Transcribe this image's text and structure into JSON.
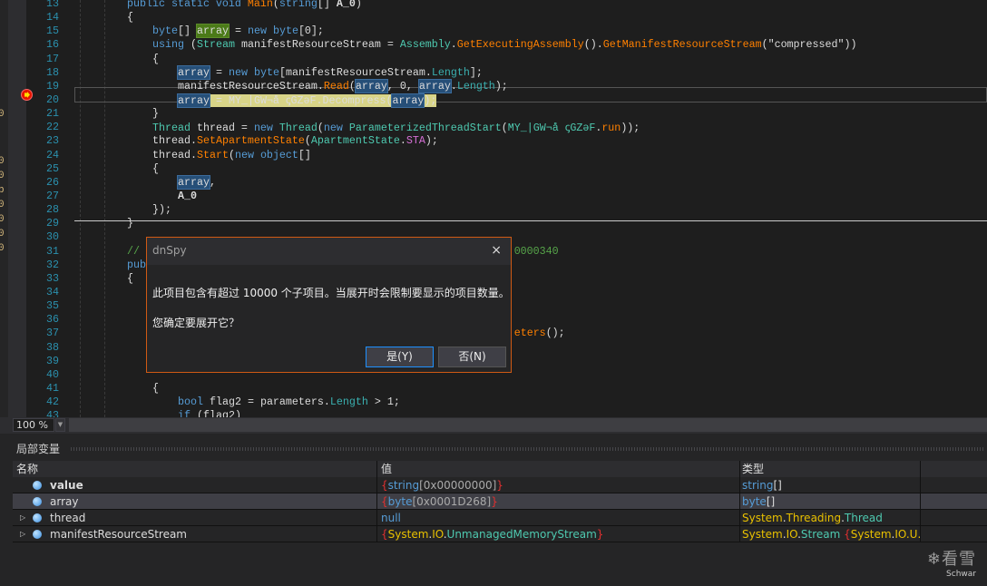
{
  "code_lines": [
    {
      "n": "13",
      "indent": 0,
      "tokens": [
        [
          "public static void ",
          "kw"
        ],
        [
          "Main",
          "me"
        ],
        [
          "(",
          "pl"
        ],
        [
          "string",
          "kw"
        ],
        [
          "[] ",
          "pl"
        ],
        [
          "A_0",
          "bo"
        ],
        [
          ")",
          "pl"
        ]
      ]
    },
    {
      "n": "14",
      "indent": 0,
      "tokens": [
        [
          "{",
          "pl"
        ]
      ]
    },
    {
      "n": "15",
      "indent": 1,
      "tokens": [
        [
          "byte",
          "kw"
        ],
        [
          "[] ",
          "pl"
        ],
        [
          "array",
          "hlg"
        ],
        [
          " = ",
          "pl"
        ],
        [
          "new ",
          "kw"
        ],
        [
          "byte",
          "kw"
        ],
        [
          "[0];",
          "pl"
        ]
      ]
    },
    {
      "n": "16",
      "indent": 1,
      "tokens": [
        [
          "using ",
          "kw"
        ],
        [
          "(",
          "pl"
        ],
        [
          "Stream ",
          "ty"
        ],
        [
          "manifestResourceStream = ",
          "pl"
        ],
        [
          "Assembly",
          "ty"
        ],
        [
          ".",
          "pl"
        ],
        [
          "GetExecutingAssembly",
          "me"
        ],
        [
          "().",
          "pl"
        ],
        [
          "GetManifestResourceStream",
          "me"
        ],
        [
          "(\"compressed\"))",
          "pl"
        ]
      ]
    },
    {
      "n": "17",
      "indent": 1,
      "tokens": [
        [
          "{",
          "pl"
        ]
      ]
    },
    {
      "n": "18",
      "indent": 2,
      "tokens": [
        [
          "array",
          "hl"
        ],
        [
          " = ",
          "pl"
        ],
        [
          "new ",
          "kw"
        ],
        [
          "byte",
          "kw"
        ],
        [
          "[manifestResourceStream.",
          "pl"
        ],
        [
          "Length",
          "pr"
        ],
        [
          "];",
          "pl"
        ]
      ]
    },
    {
      "n": "19",
      "indent": 2,
      "tokens": [
        [
          "manifestResourceStream.",
          "pl"
        ],
        [
          "Read",
          "me"
        ],
        [
          "(",
          "pl"
        ],
        [
          "array",
          "hl"
        ],
        [
          ", 0, ",
          "pl"
        ],
        [
          "array",
          "hl"
        ],
        [
          ".",
          "pl"
        ],
        [
          "Length",
          "pr"
        ],
        [
          ");",
          "pl"
        ]
      ]
    },
    {
      "n": "20",
      "indent": 2,
      "current": true,
      "tokens": [
        [
          "array",
          "hl"
        ],
        [
          " = MY_|GW¬å ꞔGZəF.Decompress(",
          "pl"
        ],
        [
          "array",
          "hl"
        ],
        [
          ");",
          "pl"
        ]
      ]
    },
    {
      "n": "21",
      "indent": 1,
      "tokens": [
        [
          "}",
          "pl"
        ]
      ]
    },
    {
      "n": "22",
      "indent": 1,
      "tokens": [
        [
          "Thread ",
          "ty"
        ],
        [
          "thread = ",
          "pl"
        ],
        [
          "new ",
          "kw"
        ],
        [
          "Thread",
          "ty"
        ],
        [
          "(",
          "pl"
        ],
        [
          "new ",
          "kw"
        ],
        [
          "ParameterizedThreadStart",
          "ty"
        ],
        [
          "(",
          "pl"
        ],
        [
          "MY_|GW¬å ꞔGZəF",
          "ty"
        ],
        [
          ".",
          "pl"
        ],
        [
          "run",
          "me"
        ],
        [
          "));",
          "pl"
        ]
      ]
    },
    {
      "n": "23",
      "indent": 1,
      "tokens": [
        [
          "thread.",
          "pl"
        ],
        [
          "SetApartmentState",
          "me"
        ],
        [
          "(",
          "pl"
        ],
        [
          "ApartmentState",
          "ty"
        ],
        [
          ".",
          "pl"
        ],
        [
          "STA",
          "en"
        ],
        [
          ");",
          "pl"
        ]
      ]
    },
    {
      "n": "24",
      "indent": 1,
      "tokens": [
        [
          "thread.",
          "pl"
        ],
        [
          "Start",
          "me"
        ],
        [
          "(",
          "pl"
        ],
        [
          "new ",
          "kw"
        ],
        [
          "object",
          "kw"
        ],
        [
          "[]",
          "pl"
        ]
      ]
    },
    {
      "n": "25",
      "indent": 1,
      "tokens": [
        [
          "{",
          "pl"
        ]
      ]
    },
    {
      "n": "26",
      "indent": 2,
      "tokens": [
        [
          "array",
          "hl"
        ],
        [
          ",",
          "pl"
        ]
      ]
    },
    {
      "n": "27",
      "indent": 2,
      "tokens": [
        [
          "A_0",
          "bo"
        ]
      ]
    },
    {
      "n": "28",
      "indent": 1,
      "tokens": [
        [
          "});",
          "pl"
        ]
      ]
    },
    {
      "n": "29",
      "indent": 0,
      "tokens": [
        [
          "}",
          "pl"
        ]
      ]
    },
    {
      "n": "30",
      "indent": 0,
      "tokens": []
    },
    {
      "n": "31",
      "indent": 0,
      "tokens": [
        [
          "//                                                           0000340",
          "cm"
        ]
      ]
    },
    {
      "n": "32",
      "indent": 0,
      "tokens": [
        [
          "pub",
          "kw"
        ]
      ]
    },
    {
      "n": "33",
      "indent": 0,
      "tokens": [
        [
          "{",
          "pl"
        ]
      ]
    },
    {
      "n": "34",
      "indent": 0,
      "tokens": []
    },
    {
      "n": "35",
      "indent": 0,
      "tokens": []
    },
    {
      "n": "36",
      "indent": 0,
      "tokens": []
    },
    {
      "n": "37",
      "indent": 0,
      "tokens": [
        [
          "                                                             ",
          "pl"
        ],
        [
          "eters",
          "me"
        ],
        [
          "();",
          "pl"
        ]
      ]
    },
    {
      "n": "38",
      "indent": 0,
      "tokens": []
    },
    {
      "n": "39",
      "indent": 0,
      "tokens": []
    },
    {
      "n": "40",
      "indent": 0,
      "tokens": []
    },
    {
      "n": "41",
      "indent": 1,
      "tokens": [
        [
          "{",
          "pl"
        ]
      ]
    },
    {
      "n": "42",
      "indent": 2,
      "tokens": [
        [
          "bool ",
          "kw"
        ],
        [
          "flag2 = parameters.",
          "pl"
        ],
        [
          "Length",
          "pr"
        ],
        [
          " > 1;",
          "pl"
        ]
      ]
    },
    {
      "n": "43",
      "indent": 2,
      "tokens": [
        [
          "if ",
          "kw"
        ],
        [
          "(flag2)",
          "pl"
        ]
      ]
    }
  ],
  "left_strip_chars": [
    "0",
    "0",
    "0",
    "b",
    "0",
    "0",
    "0",
    "0"
  ],
  "zoom": {
    "value": "100 %"
  },
  "locals": {
    "title": "局部变量",
    "columns": [
      "名称",
      "值",
      "类型"
    ],
    "rows": [
      {
        "name": "value",
        "bold": true,
        "expandable": false,
        "value": [
          [
            "{",
            "rb"
          ],
          [
            "string",
            "bl"
          ],
          [
            "[0x00000000]",
            "gr"
          ],
          [
            "}",
            "rb"
          ]
        ],
        "type": [
          [
            "string",
            "bl"
          ],
          [
            "[]",
            "pl"
          ]
        ]
      },
      {
        "name": "array",
        "bold": false,
        "expandable": false,
        "selected": true,
        "value": [
          [
            "{",
            "rb"
          ],
          [
            "byte",
            "bl"
          ],
          [
            "[0x0001D268]",
            "gr"
          ],
          [
            "}",
            "rb"
          ]
        ],
        "type": [
          [
            "byte",
            "bl"
          ],
          [
            "[]",
            "pl"
          ]
        ]
      },
      {
        "name": "thread",
        "bold": false,
        "expandable": true,
        "value": [
          [
            "null",
            "bl"
          ]
        ],
        "type": [
          [
            "System",
            "yl"
          ],
          [
            ".",
            "pl"
          ],
          [
            "Threading",
            "yl"
          ],
          [
            ".",
            "pl"
          ],
          [
            "Thread",
            "tl"
          ]
        ]
      },
      {
        "name": "manifestResourceStream",
        "bold": false,
        "expandable": true,
        "value": [
          [
            "{",
            "rb"
          ],
          [
            "System",
            "yl"
          ],
          [
            ".",
            "pl"
          ],
          [
            "IO",
            "yl"
          ],
          [
            ".",
            "pl"
          ],
          [
            "UnmanagedMemoryStream",
            "tl"
          ],
          [
            "}",
            "rb"
          ]
        ],
        "type": [
          [
            "System",
            "yl"
          ],
          [
            ".",
            "pl"
          ],
          [
            "IO",
            "yl"
          ],
          [
            ".",
            "pl"
          ],
          [
            "Stream ",
            "tl"
          ],
          [
            "{",
            "rb"
          ],
          [
            "System",
            "yl"
          ],
          [
            ".",
            "pl"
          ],
          [
            "IO",
            "yl"
          ],
          [
            ".U...",
            "yl"
          ]
        ]
      }
    ]
  },
  "dialog": {
    "title": "dnSpy",
    "message": "此项目包含有超过 10000 个子项目。当展开时会限制要显示的项目数量。",
    "question": "您确定要展开它？",
    "yes_label": "是(Y)",
    "no_label": "否(N)",
    "close_icon": "×"
  },
  "watermark": {
    "logo_text": "看雪",
    "sub": "Schwar"
  },
  "colors": {
    "accent_border": "#d05a14",
    "keyword": "#569cd6",
    "type": "#4ec9b0",
    "method": "#ff8000",
    "highlight": "#264f78",
    "current_statement": "#d8d488"
  }
}
